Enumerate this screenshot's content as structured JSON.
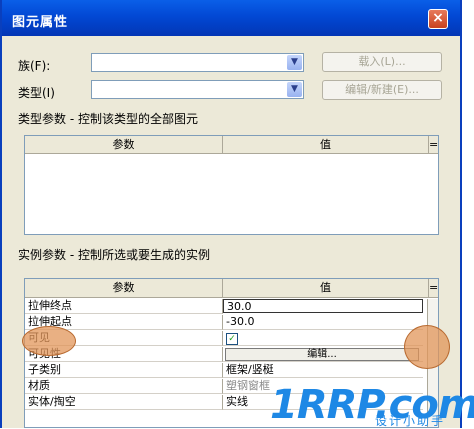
{
  "window": {
    "title": "图元属性",
    "close": "×"
  },
  "family": {
    "label": "族(F):",
    "value": ""
  },
  "type": {
    "label": "类型(I)",
    "value": ""
  },
  "buttons": {
    "load": "载入(L)...",
    "edit_new": "编辑/新建(E)..."
  },
  "type_params": {
    "section_title": "类型参数 - 控制该类型的全部图元",
    "columns": [
      "参数",
      "值"
    ],
    "filter": "="
  },
  "instance_params": {
    "section_title": "实例参数 - 控制所选或要生成的实例",
    "columns": [
      "参数",
      "值"
    ],
    "filter": "=",
    "rows": [
      {
        "name": "拉伸终点",
        "value": "30.0"
      },
      {
        "name": "拉伸起点",
        "value": "-30.0"
      },
      {
        "name": "可见",
        "value": "✓"
      },
      {
        "name": "可见性",
        "value": "编辑..."
      },
      {
        "name": "子类别",
        "value": "框架/竖梃"
      },
      {
        "name": "材质",
        "value": "塑钢窗框"
      },
      {
        "name": "实体/掏空",
        "value": "实线"
      }
    ]
  },
  "watermark": {
    "brand": "1RRP.com",
    "sub": "设计小助手"
  },
  "colors": {
    "titlebar": "#0248d4",
    "dialog_bg": "#ece9d8",
    "highlight": "#e1965a",
    "watermark": "#1e88e5"
  }
}
